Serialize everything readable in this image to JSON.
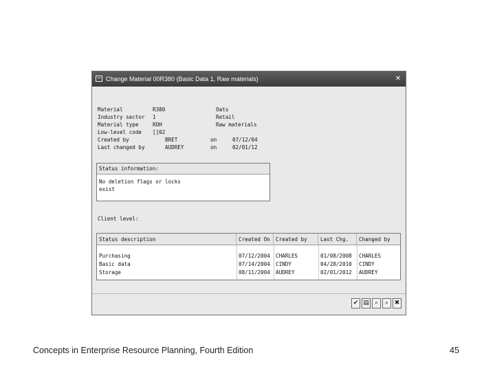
{
  "window": {
    "title": "Change Material 00R380 (Basic Data 1, Raw materials)"
  },
  "header": {
    "material_label": "Material",
    "material_value": "R380",
    "material_desc": "Oats",
    "industry_label": "Industry sector",
    "industry_value": "1",
    "industry_desc": "Retail",
    "mattype_label": "Material type",
    "mattype_value": "ROH",
    "mattype_desc": "Raw materials",
    "lowlevel_label": "Low-level code",
    "lowlevel_value": "[]02",
    "createdby_label": "Created by",
    "createdby_value": "BRET",
    "createdby_on": "on",
    "createdby_date": "07/12/04",
    "changedby_label": "Last changed by",
    "changedby_value": "AUDREY",
    "changedby_on": "on",
    "changedby_date": "02/01/12"
  },
  "status": {
    "heading": "Status information:",
    "line1": "No deletion flags or locks",
    "line2": "exist"
  },
  "client_level": "Client level:",
  "table": {
    "columns": [
      "Status description",
      "Created On",
      "Created by",
      "Last Chg.",
      "Changed by"
    ],
    "rows": [
      [
        "Purchasing",
        "07/12/2004",
        "CHARLES",
        "01/08/2008",
        "CHARLES"
      ],
      [
        "Basic data",
        "07/14/2004",
        "CINDY",
        "04/28/2010",
        "CINDY"
      ],
      [
        "Storage",
        "08/11/2004",
        "AUDREY",
        "02/01/2012",
        "AUDREY"
      ]
    ]
  },
  "toolbar": {
    "icons": [
      "check-icon",
      "document-icon",
      "binoculars-icon",
      "binoculars-next-icon",
      "cancel-icon"
    ],
    "glyphs": [
      "✔",
      "▤",
      "⌕",
      "⌕",
      "✖"
    ]
  },
  "footer": {
    "text": "Concepts in Enterprise Resource Planning, Fourth Edition",
    "page": "45"
  }
}
